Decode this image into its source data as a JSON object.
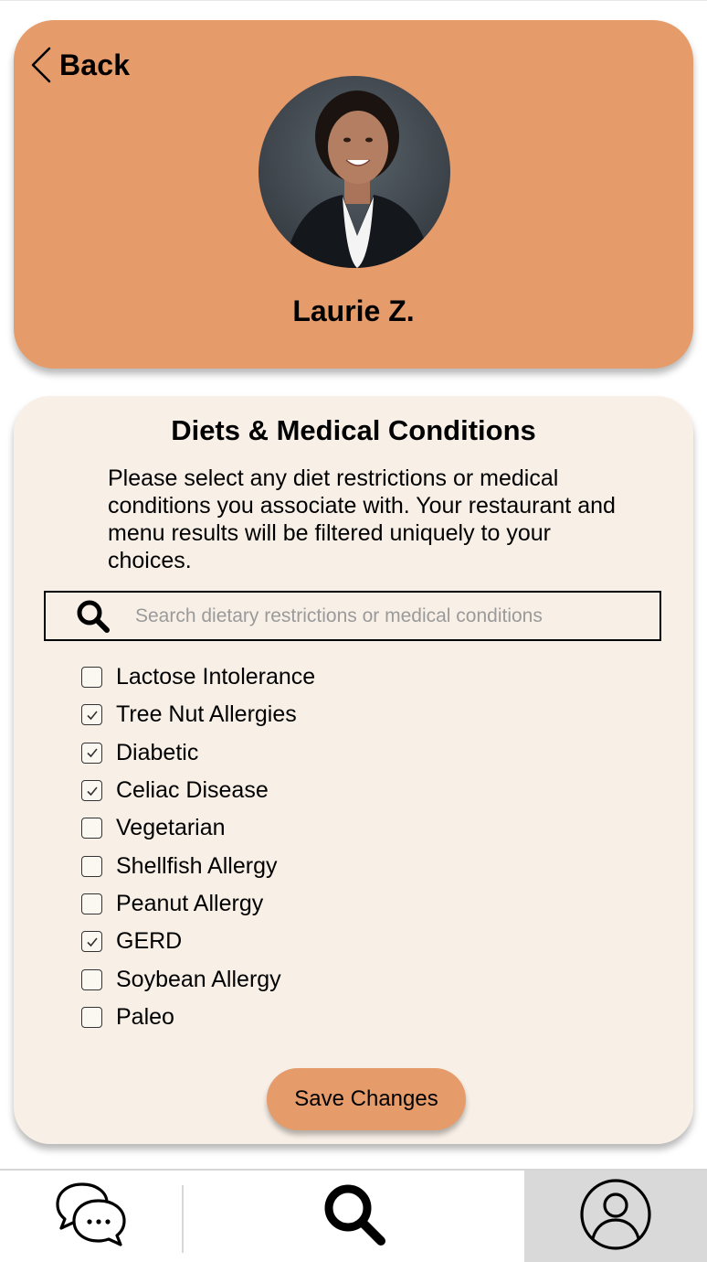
{
  "header": {
    "back_label": "Back",
    "profile_name": "Laurie Z."
  },
  "diets": {
    "title": "Diets & Medical Conditions",
    "description": "Please select any diet restrictions or medical conditions you associate with. Your restaurant and menu results will be filtered uniquely to your choices.",
    "search_placeholder": "Search dietary restrictions or medical conditions",
    "search_value": "",
    "options": [
      {
        "label": "Lactose Intolerance",
        "checked": false
      },
      {
        "label": "Tree Nut Allergies",
        "checked": true
      },
      {
        "label": "Diabetic",
        "checked": true
      },
      {
        "label": "Celiac Disease",
        "checked": true
      },
      {
        "label": "Vegetarian",
        "checked": false
      },
      {
        "label": "Shellfish Allergy",
        "checked": false
      },
      {
        "label": "Peanut Allergy",
        "checked": false
      },
      {
        "label": "GERD",
        "checked": true
      },
      {
        "label": "Soybean Allergy",
        "checked": false
      },
      {
        "label": "Paleo",
        "checked": false
      }
    ],
    "save_label": "Save Changes"
  },
  "bottom_nav": {
    "items": [
      {
        "icon": "chat-bubbles-icon",
        "active": false
      },
      {
        "icon": "search-icon",
        "active": false
      },
      {
        "icon": "profile-icon",
        "active": true
      }
    ]
  },
  "colors": {
    "accent": "#e69b6b",
    "card_background": "#f8f0e7",
    "active_nav_background": "#d9d9d9"
  }
}
